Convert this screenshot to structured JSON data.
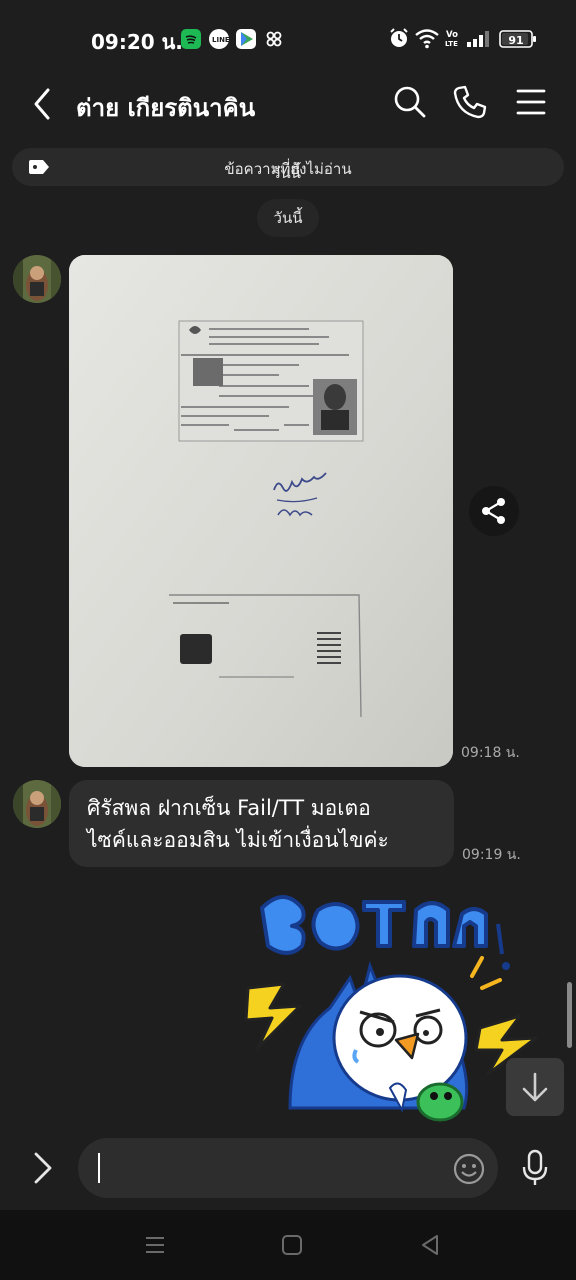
{
  "status_bar": {
    "time": "09:20 น.",
    "battery": "91",
    "app_icons": [
      "spotify-icon",
      "line-icon",
      "play-games-icon",
      "pinwheel-icon"
    ],
    "right_icons": [
      "alarm-icon",
      "wifi-icon",
      "volte-icon",
      "signal-icon",
      "battery-icon"
    ],
    "volte": "Vo\nLTE"
  },
  "header": {
    "title": "ต่าย เกียรตินาคิน",
    "icons": [
      "back-arrow-icon",
      "search-icon",
      "phone-icon",
      "menu-icon"
    ]
  },
  "unread_banner": {
    "text": "ข้อความที่ยังไม่อ่าน",
    "overlay_text": "วันนี้"
  },
  "date_chip": "วันนี้",
  "messages": [
    {
      "type": "image",
      "time": "09:18 น."
    },
    {
      "type": "text",
      "lines": [
        "ศิรัสพล ฝากเซ็น Fail/TT มอเตอ",
        "ไซค์และออมสิน ไม่เข้าเงื่อนไขค่ะ"
      ],
      "time": "09:19 น."
    },
    {
      "type": "sticker"
    }
  ],
  "input": {
    "placeholder": ""
  },
  "colors": {
    "background": "#1e1e1e",
    "bubble": "#2e2e2e",
    "sticker_blue": "#2f6fd8",
    "sticker_yellow": "#f4d21f"
  }
}
